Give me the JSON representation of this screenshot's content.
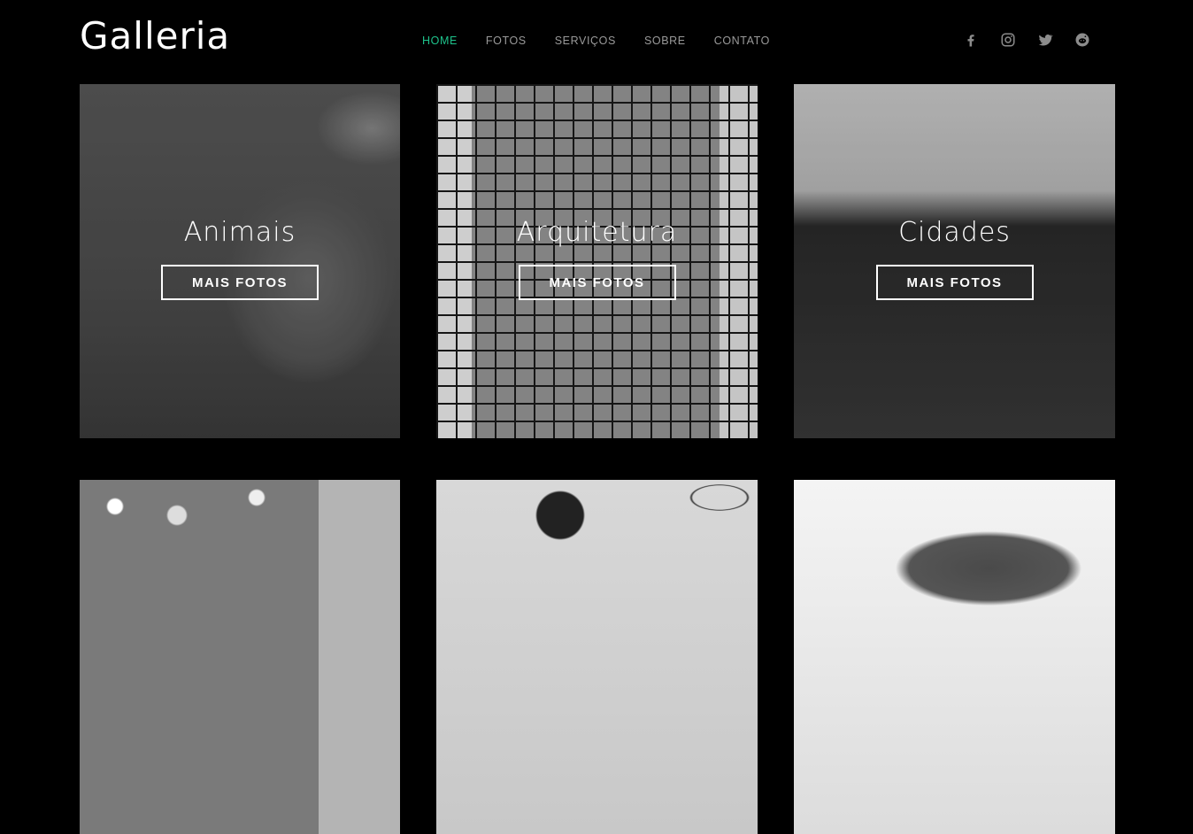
{
  "brand": {
    "logo": "Galleria"
  },
  "nav": {
    "items": [
      {
        "label": "HOME",
        "active": true
      },
      {
        "label": "FOTOS",
        "active": false
      },
      {
        "label": "SERVIÇOS",
        "active": false
      },
      {
        "label": "SOBRE",
        "active": false
      },
      {
        "label": "CONTATO",
        "active": false
      }
    ],
    "active_color": "#1ec28b"
  },
  "social": [
    "facebook-icon",
    "instagram-icon",
    "twitter-icon",
    "reddit-icon"
  ],
  "gallery": {
    "cards": [
      {
        "title": "Animais",
        "button": "MAIS FOTOS"
      },
      {
        "title": "Arquitetura",
        "button": "MAIS FOTOS"
      },
      {
        "title": "Cidades",
        "button": "MAIS FOTOS"
      },
      {
        "title": "",
        "button": ""
      },
      {
        "title": "",
        "button": ""
      },
      {
        "title": "",
        "button": ""
      }
    ]
  }
}
